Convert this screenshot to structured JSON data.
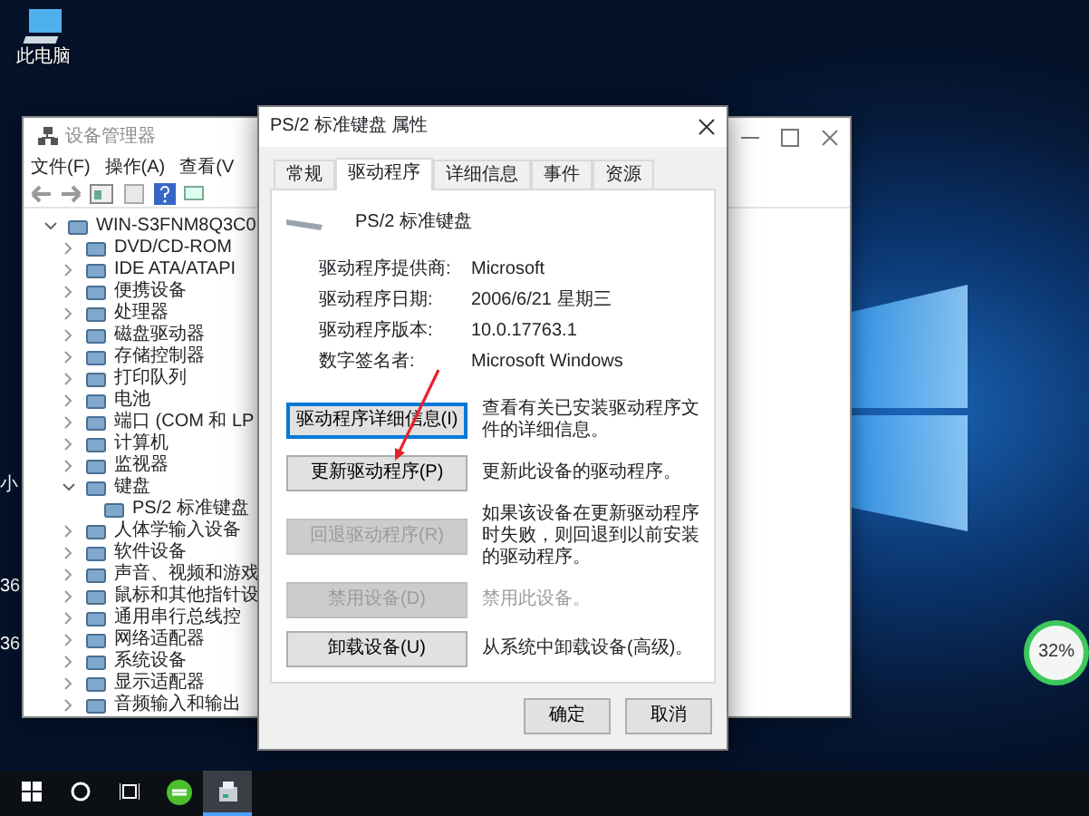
{
  "desktop": {
    "icons": [
      {
        "label": "此电脑"
      }
    ],
    "fragments": [
      "小",
      "36",
      "36"
    ]
  },
  "device_manager": {
    "title": "设备管理器",
    "menu": [
      "文件(F)",
      "操作(A)",
      "查看(V"
    ],
    "tree": [
      {
        "label": "WIN-S3FNM8Q3C0",
        "expanded": true,
        "children": [
          {
            "label": "DVD/CD-ROM",
            "expanded": false
          },
          {
            "label": "IDE ATA/ATAPI",
            "expanded": false
          },
          {
            "label": "便携设备",
            "expanded": false
          },
          {
            "label": "处理器",
            "expanded": false
          },
          {
            "label": "磁盘驱动器",
            "expanded": false
          },
          {
            "label": "存储控制器",
            "expanded": false
          },
          {
            "label": "打印队列",
            "expanded": false
          },
          {
            "label": "电池",
            "expanded": false
          },
          {
            "label": "端口 (COM 和 LP",
            "expanded": false
          },
          {
            "label": "计算机",
            "expanded": false
          },
          {
            "label": "监视器",
            "expanded": false
          },
          {
            "label": "键盘",
            "expanded": true,
            "children": [
              {
                "label": "PS/2 标准键盘"
              }
            ]
          },
          {
            "label": "人体学输入设备",
            "expanded": false
          },
          {
            "label": "软件设备",
            "expanded": false
          },
          {
            "label": "声音、视频和游戏",
            "expanded": false
          },
          {
            "label": "鼠标和其他指针设",
            "expanded": false
          },
          {
            "label": "通用串行总线控",
            "expanded": false
          },
          {
            "label": "网络适配器",
            "expanded": false
          },
          {
            "label": "系统设备",
            "expanded": false
          },
          {
            "label": "显示适配器",
            "expanded": false
          },
          {
            "label": "音频输入和输出",
            "expanded": false
          }
        ]
      }
    ]
  },
  "dialog": {
    "title": "PS/2 标准键盘 属性",
    "tabs": [
      {
        "label": "常规",
        "selected": false
      },
      {
        "label": "驱动程序",
        "selected": true
      },
      {
        "label": "详细信息",
        "selected": false
      },
      {
        "label": "事件",
        "selected": false
      },
      {
        "label": "资源",
        "selected": false
      }
    ],
    "device_name": "PS/2 标准键盘",
    "info": [
      {
        "label": "驱动程序提供商:",
        "value": "Microsoft"
      },
      {
        "label": "驱动程序日期:",
        "value": "2006/6/21 星期三"
      },
      {
        "label": "驱动程序版本:",
        "value": "10.0.17763.1"
      },
      {
        "label": "数字签名者:",
        "value": "Microsoft Windows"
      }
    ],
    "actions": [
      {
        "button": "驱动程序详细信息(I)",
        "description": "查看有关已安装驱动程序文件的详细信息。",
        "focused": true,
        "disabled": false,
        "description_dimmed": false
      },
      {
        "button": "更新驱动程序(P)",
        "description": "更新此设备的驱动程序。",
        "focused": false,
        "disabled": false,
        "description_dimmed": false,
        "annotated": true
      },
      {
        "button": "回退驱动程序(R)",
        "description": "如果该设备在更新驱动程序时失败，则回退到以前安装的驱动程序。",
        "focused": false,
        "disabled": true,
        "description_dimmed": false
      },
      {
        "button": "禁用设备(D)",
        "description": "禁用此设备。",
        "focused": false,
        "disabled": true,
        "description_dimmed": true
      },
      {
        "button": "卸载设备(U)",
        "description": "从系统中卸载设备(高级)。",
        "focused": false,
        "disabled": false,
        "description_dimmed": false
      }
    ],
    "footer_buttons": [
      "确定",
      "取消"
    ]
  },
  "widget": {
    "reading": "32%"
  },
  "taskbar": {
    "items": [
      {
        "kind": "start",
        "selected": false
      },
      {
        "kind": "search",
        "selected": false
      },
      {
        "kind": "task-view",
        "selected": false
      },
      {
        "kind": "app-360",
        "selected": false
      },
      {
        "kind": "device-manager",
        "selected": true
      }
    ]
  }
}
